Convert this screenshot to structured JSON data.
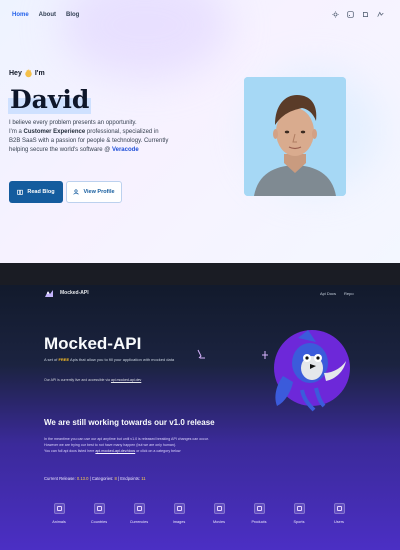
{
  "nav": {
    "items": [
      "Home",
      "About",
      "Blog"
    ],
    "icons": [
      "sun-icon",
      "rss-icon",
      "github-icon",
      "linkedin-icon"
    ]
  },
  "hero": {
    "greeting": "Hey",
    "greeting_suffix": "I'm",
    "name": "David",
    "line1": "I believe every problem presents an opportunity.",
    "line2_pre": "I'm a",
    "line2_bold": "Customer Experience",
    "line2_post": "professional, specialized in",
    "line3": "B2B SaaS with a passion for people & technology. Currently",
    "line4_pre": "helping secure the world's software @",
    "line4_link": "Veracode",
    "read_blog": "Read Blog",
    "view_profile": "View Profile"
  },
  "mocked": {
    "brand": "Mocked-API",
    "nav": [
      "Api Docs",
      "Repo"
    ],
    "title": "Mocked-API",
    "desc_pre": "A set of",
    "desc_free": "FREE",
    "desc_post": "Apis that allow you to fill your application with mocked data",
    "note_pre": "Our API is currently live and accessible via",
    "note_link": "api.mocked-api.dev",
    "headline": "We are still working towards our v1.0 release",
    "para1": "In the meantime you can use our api anytime but until v1.0 is released breaking API changes can occur.",
    "para2": "However we are trying our best to not have many happen (but we are only human).",
    "para3_pre": "You can full api docs listed here",
    "para3_link": "api.mocked-api.dev/docs",
    "para3_post": "or click on a category below",
    "status_release_label": "Current Release:",
    "status_release": "0.13.0",
    "status_categories_label": "Categories:",
    "status_categories": "8",
    "status_endpoints_label": "Endpoints:",
    "status_endpoints": "11",
    "categories": [
      "Animals",
      "Countries",
      "Currencies",
      "Images",
      "Movies",
      "Products",
      "Sports",
      "Users"
    ]
  },
  "colors": {
    "accent": "#145c9e",
    "portrait_bg": "#a6d8f5",
    "purple": "#4b2fc4"
  }
}
